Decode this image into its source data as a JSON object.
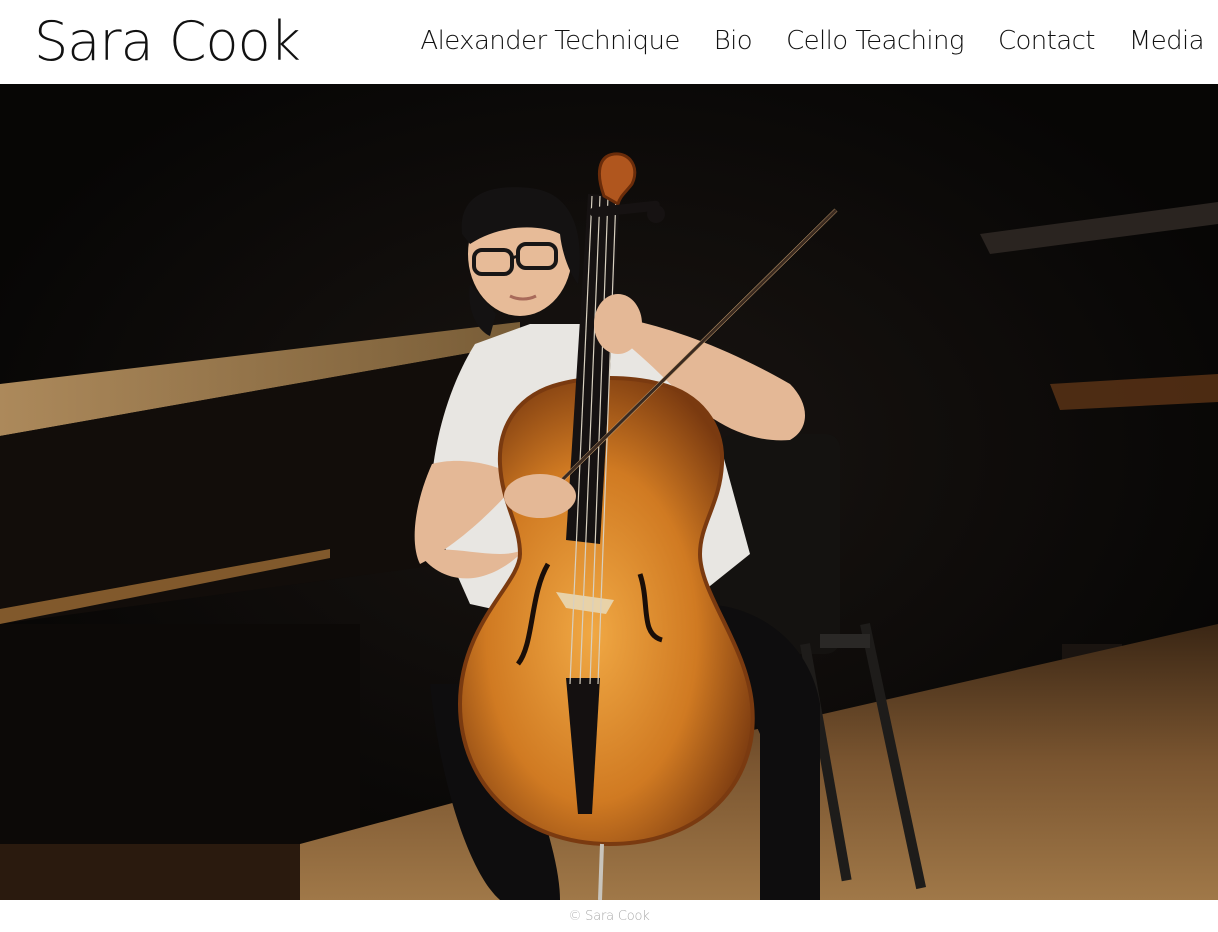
{
  "site": {
    "title": "Sara Cook"
  },
  "nav": {
    "items": [
      {
        "label": "Alexander Technique"
      },
      {
        "label": "Bio"
      },
      {
        "label": "Cello Teaching"
      },
      {
        "label": "Contact"
      },
      {
        "label": "Media"
      }
    ]
  },
  "hero": {
    "image_subject": "cellist performing on stage",
    "colors": {
      "background": "#0b0908",
      "stage_floor": "#6a4a2a",
      "cello_body": "#d4852a",
      "shirt": "#e8e6e2"
    }
  },
  "footer": {
    "copyright": "© Sara Cook"
  }
}
